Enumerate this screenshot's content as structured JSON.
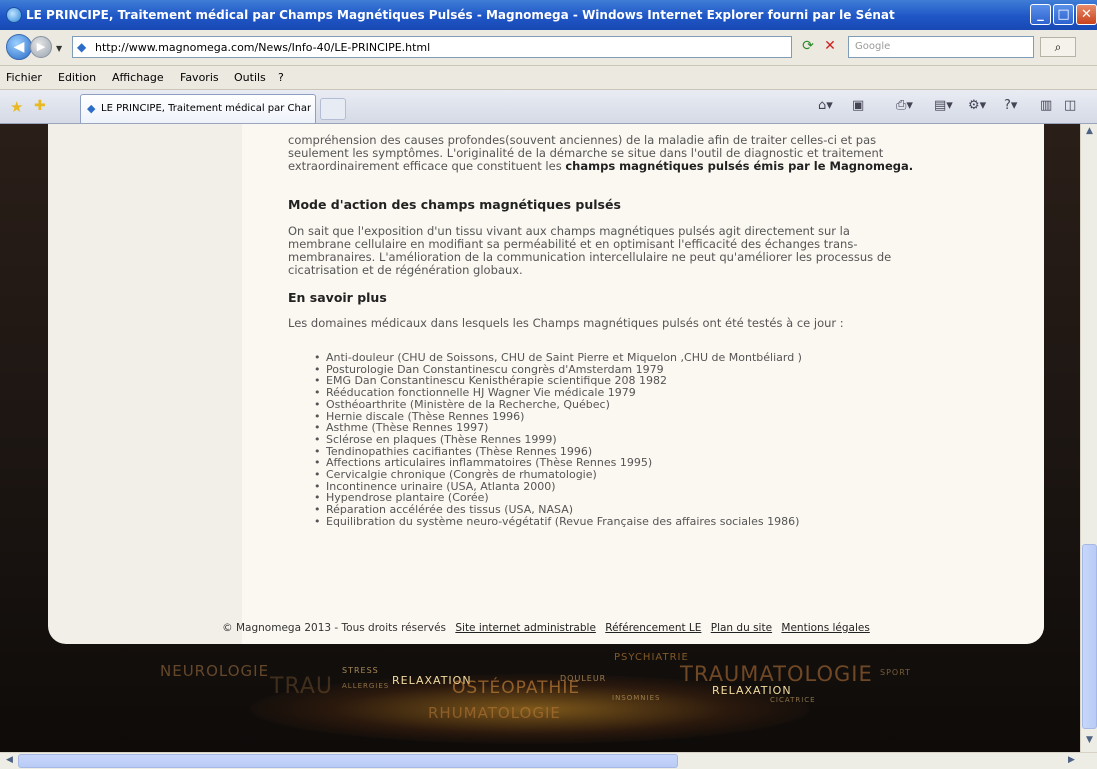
{
  "window": {
    "title": "LE PRINCIPE, Traitement médical par Champs Magnétiques Pulsés - Magnomega - Windows Internet Explorer fourni par le Sénat",
    "minimize_icon": "minimize-icon",
    "maximize_icon": "maximize-icon",
    "close_icon": "close-icon"
  },
  "address": {
    "url": "http://www.magnomega.com/News/Info-40/LE-PRINCIPE.html",
    "search_placeholder": "Google"
  },
  "menu": [
    "Fichier",
    "Edition",
    "Affichage",
    "Favoris",
    "Outils",
    "?"
  ],
  "tab": {
    "label": "LE PRINCIPE, Traitement médical par Champs Magnéti..."
  },
  "content": {
    "intro_lines": [
      "compréhension des causes profondes(souvent anciennes) de la maladie afin de traiter celles-ci et pas",
      "seulement les symptômes. L'originalité de la démarche se situe dans l'outil de diagnostic et traitement"
    ],
    "intro_last_plain": "extraordinairement efficace que constituent les ",
    "intro_last_bold": "champs magnétiques pulsés émis par le Magnomega.",
    "heading_mode": "Mode d'action des champs magnétiques pulsés",
    "mode_lines": [
      "On sait que l'exposition d'un tissu vivant aux champs magnétiques pulsés agit directement sur la",
      "membrane cellulaire en modifiant sa perméabilité et en optimisant l'efficacité des échanges trans-",
      "membranaires. L'amélioration de la communication intercellulaire ne peut qu'améliorer les processus de",
      "cicatrisation et de régénération globaux."
    ],
    "heading_more": "En savoir plus",
    "more_intro": "Les domaines médicaux dans lesquels les Champs magnétiques pulsés ont été testés à ce jour :",
    "domains": [
      "Anti-douleur (CHU de Soissons, CHU de Saint Pierre et Miquelon ,CHU de Montbéliard )",
      "Posturologie Dan Constantinescu congrès d'Amsterdam 1979",
      "EMG Dan Constantinescu Kenisthérapie scientifique 208 1982",
      "Rééducation fonctionnelle HJ Wagner Vie médicale 1979",
      "Osthéoarthrite (Ministère de la Recherche, Québec)",
      "Hernie discale (Thèse Rennes 1996)",
      "Asthme (Thèse Rennes 1997)",
      "Sclérose en plaques (Thèse Rennes 1999)",
      "Tendinopathies cacifiantes (Thèse Rennes 1996)",
      "Affections articulaires inflammatoires  (Thèse Rennes 1995)",
      "Cervicalgie chronique (Congrès de rhumatologie)",
      "Incontinence urinaire (USA, Atlanta 2000)",
      "Hypendrose plantaire (Corée)",
      "Réparation accélérée des tissus (USA, NASA)",
      "Equilibration du système neuro-végétatif (Revue Française des affaires sociales 1986)"
    ]
  },
  "footer": {
    "copyright": "© Magnomega 2013 - Tous droits réservés",
    "links": [
      "Site internet administrable",
      "Référencement LE",
      "Plan du site",
      "Mentions légales"
    ]
  },
  "banner": {
    "words": [
      "NEUROLOGIE",
      "TRAU",
      "STRESS",
      "RELAXATION",
      "OSTÉOPATHIE",
      "PSYCHIATRIE",
      "TRAUMATOLOGIE",
      "RELAXATION",
      "RHUMATOLOGIE",
      "ALLERGIES",
      "SPORT",
      "INSOMNIES",
      "DOULEUR",
      "CICATRICE"
    ]
  },
  "colors": {
    "title_bar": "#1f56c6",
    "page_bg": "#fbf8f1",
    "banner_bg": "#1a1411",
    "banner_accent": "#d7962b"
  }
}
